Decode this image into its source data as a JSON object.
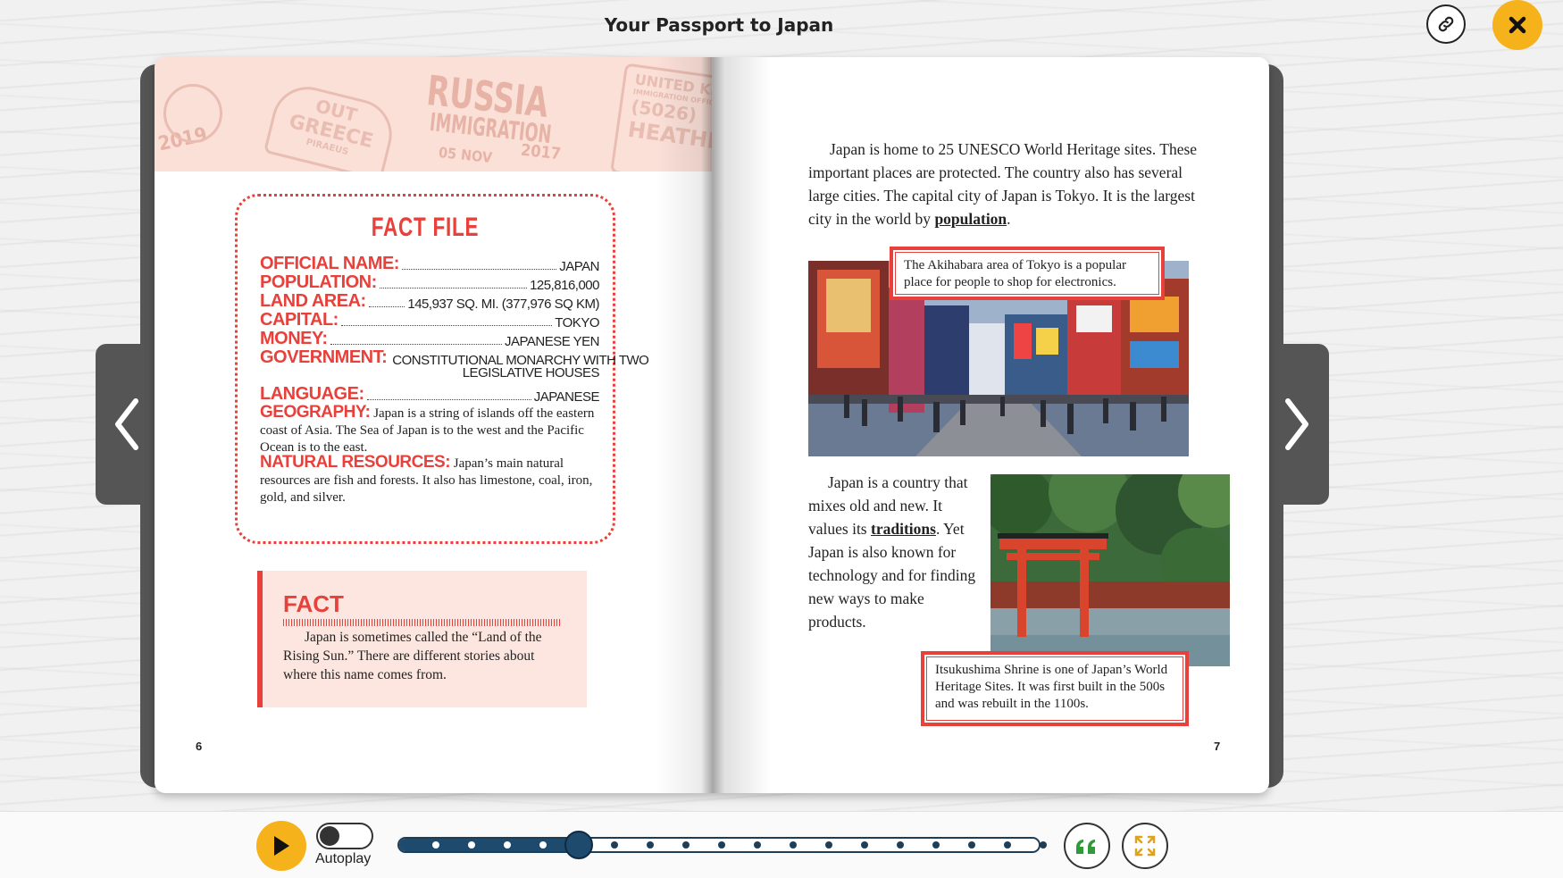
{
  "header": {
    "title": "Your Passport to Japan"
  },
  "icons": {
    "link": "link-icon",
    "close": "close-icon",
    "prev": "chevron-left-icon",
    "next": "chevron-right-icon",
    "play": "play-icon",
    "quote": "quote-icon",
    "fullscreen": "fullscreen-icon"
  },
  "colors": {
    "accent": "#e8403a",
    "button_yellow": "#f6b21a",
    "progress_navy": "#1e4a6e",
    "stamp_band": "#fbe0d8"
  },
  "left_page": {
    "stamps": [
      "2019",
      "OUT",
      "GREECE",
      "PIRAEUS",
      "RUSSIA",
      "IMMIGRATION",
      "05 NOV",
      "2017",
      "UNITED KING",
      "IMMIGRATION OFFICER",
      "(5026)",
      "HEATHRO"
    ],
    "fact_file": {
      "title": "FACT FILE",
      "rows": [
        {
          "label": "OFFICIAL NAME:",
          "value": "JAPAN"
        },
        {
          "label": "POPULATION:",
          "value": "125,816,000"
        },
        {
          "label": "LAND AREA:",
          "value": "145,937 SQ. MI. (377,976 SQ KM)"
        },
        {
          "label": "CAPITAL:",
          "value": "TOKYO"
        },
        {
          "label": "MONEY:",
          "value": "JAPANESE YEN"
        },
        {
          "label": "GOVERNMENT:",
          "value": "CONSTITUTIONAL MONARCHY WITH TWO",
          "value2": "LEGISLATIVE HOUSES"
        },
        {
          "label": "LANGUAGE:",
          "value": "JAPANESE"
        }
      ],
      "geography_label": "GEOGRAPHY:",
      "geography_text": "Japan is a string of islands off the eastern coast of Asia. The Sea of Japan is to the west and the Pacific Ocean is to the east.",
      "resources_label": "NATURAL RESOURCES:",
      "resources_text": "Japan’s main natural resources are fish and forests. It also has limestone, coal, iron, gold, and silver."
    },
    "fact_box": {
      "title": "FACT",
      "text": "Japan is sometimes called the “Land of the Rising Sun.” There are different stories about where this name comes from."
    },
    "page_number": "6"
  },
  "right_page": {
    "para1_pre": "Japan is home to 25 UNESCO World Heritage sites. These important places are protected. The country also has several large cities. The capital city of Japan is Tokyo. It is the largest city in the world by ",
    "para1_link": "population",
    "para1_post": ".",
    "caption1": "The Akihabara area of Tokyo is a popular place for people to shop for electronics.",
    "para2_pre": "Japan is a country that mixes old and new. It values its ",
    "para2_link": "traditions",
    "para2_post": ". Yet Japan is also known for technology and for finding new ways to make products.",
    "caption2": "Itsukushima Shrine is one of Japan’s World Heritage Sites. It was first built in the 500s and was rebuilt in the 1100s.",
    "page_number": "7"
  },
  "player": {
    "autoplay_label": "Autoplay",
    "autoplay_on": false,
    "progress": {
      "current_stop": 4,
      "total_stops": 18
    }
  }
}
